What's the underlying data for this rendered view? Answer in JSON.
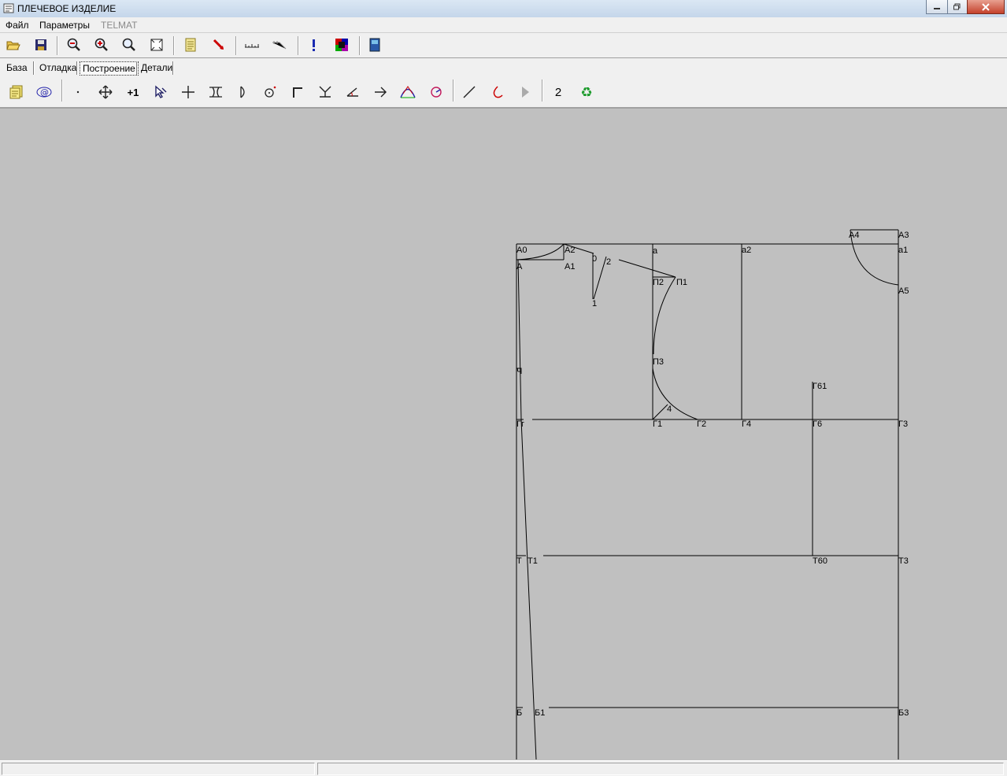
{
  "window": {
    "title": "ПЛЕЧЕВОЕ ИЗДЕЛИЕ",
    "controls": [
      "minimize-icon",
      "maximize-icon",
      "close-icon"
    ]
  },
  "menu": {
    "file": "Файл",
    "params": "Параметры",
    "telmat": "TELMAT"
  },
  "toolbar1": {
    "icons": [
      "open-folder-icon",
      "save-icon",
      "zoom-out-icon",
      "zoom-in-icon",
      "zoom-icon",
      "fit-window-icon",
      "document-icon",
      "pointer-icon",
      "measure-icon",
      "measure-angle-icon",
      "info-icon",
      "palette-icon",
      "book-icon"
    ]
  },
  "tabs": {
    "items": [
      "База",
      "Отладка",
      "Построение",
      "Детали"
    ],
    "active": "Построение"
  },
  "toolbar2": {
    "icons": [
      "notes-icon",
      "at-icon",
      "point-icon",
      "move-icon",
      "plus-one-icon",
      "select-icon",
      "cross-icon",
      "bracket-icon",
      "half-circle-icon",
      "circle-point-icon",
      "corner-icon",
      "perpendicular-icon",
      "angle-icon",
      "arrow-icon",
      "curve-icon",
      "circle-arc-icon",
      "line-icon",
      "arc-icon",
      "play-icon",
      "recycle-icon"
    ],
    "plus_one_label": "+1",
    "number_label": "2"
  },
  "drawing": {
    "labels": {
      "A0": "А0",
      "A": "А",
      "A2": "А2",
      "A1": "А1",
      "O": "0",
      "two": "2",
      "one": "1",
      "a": "а",
      "a2": "а2",
      "A4": "А4",
      "A3": "А3",
      "a1": "а1",
      "A5": "А5",
      "P2": "П2",
      "P1": "П1",
      "P3": "П3",
      "four": "4",
      "ch": "Ч",
      "Gg": "Гг",
      "G1": "Г1",
      "G2": "Г2",
      "G4": "Г4",
      "G6": "Г6",
      "G3": "Г3",
      "G61": "Г61",
      "T": "Т",
      "T1": "Т1",
      "T60": "Т60",
      "T3": "Т3",
      "B": "Б",
      "B1": "Б1",
      "B3": "Б3"
    }
  }
}
